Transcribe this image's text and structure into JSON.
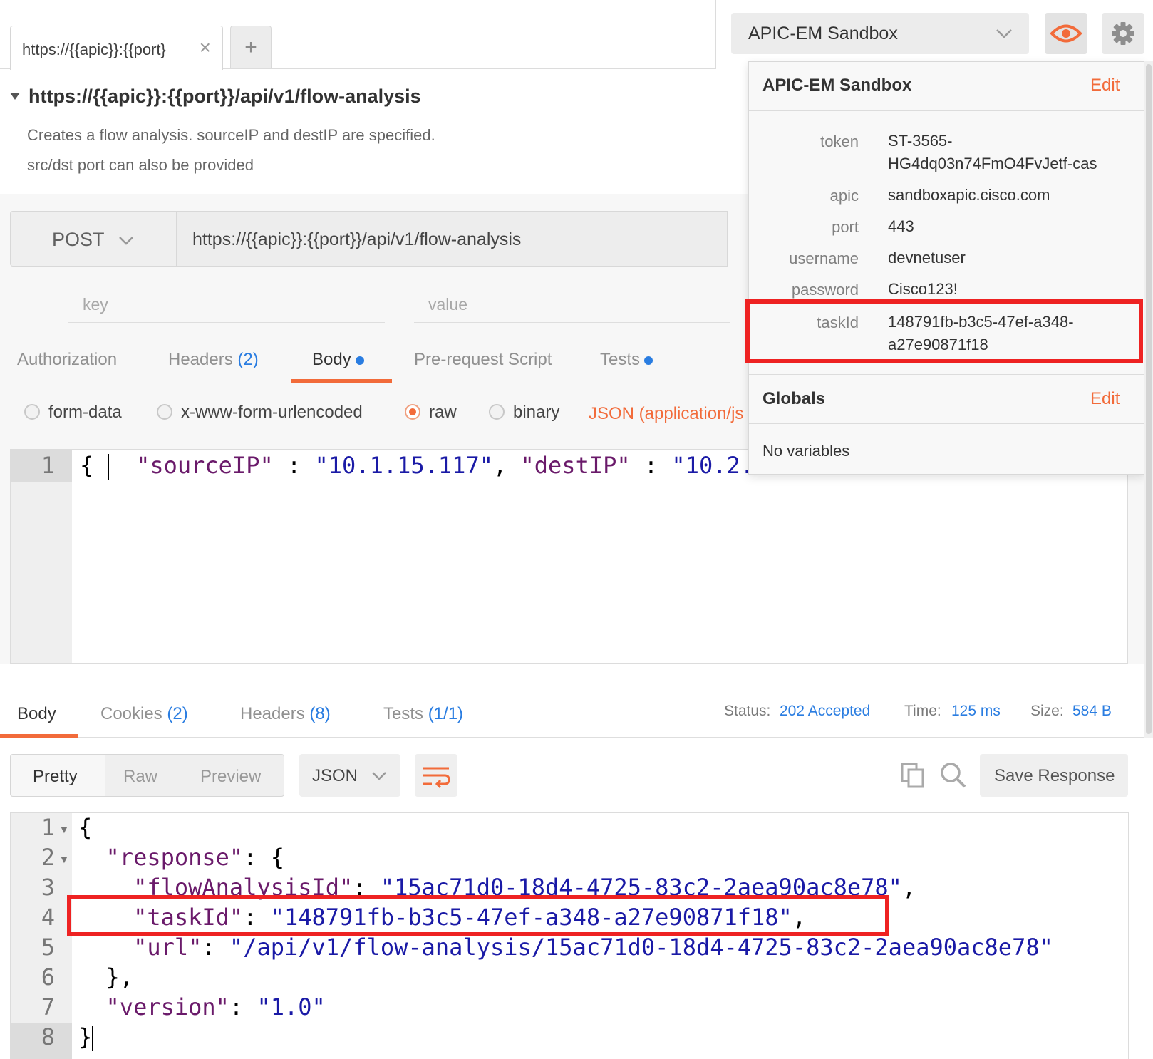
{
  "tab": {
    "label": "https://{{apic}}:{{port}",
    "add": "+"
  },
  "env": {
    "selected": "APIC-EM Sandbox"
  },
  "request": {
    "title": "https://{{apic}}:{{port}}/api/v1/flow-analysis",
    "description_line1": "Creates a flow analysis. sourceIP and destIP are specified.",
    "description_line2": "src/dst port can also be provided",
    "method": "POST",
    "url": "https://{{apic}}:{{port}}/api/v1/flow-analysis",
    "params": {
      "key_placeholder": "key",
      "value_placeholder": "value"
    }
  },
  "request_tabs": {
    "authorization": "Authorization",
    "headers": "Headers",
    "headers_count": "(2)",
    "body": "Body",
    "prerequest": "Pre-request Script",
    "tests": "Tests"
  },
  "body_types": {
    "form_data": "form-data",
    "urlencoded": "x-www-form-urlencoded",
    "raw": "raw",
    "binary": "binary",
    "json_type": "JSON (application/js"
  },
  "request_body": {
    "line_no": "1",
    "open": "{ ",
    "k1": "\"sourceIP\"",
    "sep1": " : ",
    "v1": "\"10.1.15.117\"",
    "comma": ", ",
    "k2": "\"destIP\"",
    "sep2": " : ",
    "v2": "\"10.2."
  },
  "response_tabs": {
    "body": "Body",
    "cookies": "Cookies",
    "cookies_count": "(2)",
    "headers": "Headers",
    "headers_count": "(8)",
    "tests": "Tests",
    "tests_count": "(1/1)"
  },
  "response_status": {
    "status_label": "Status:",
    "status_value": "202 Accepted",
    "time_label": "Time:",
    "time_value": "125 ms",
    "size_label": "Size:",
    "size_value": "584 B"
  },
  "response_view": {
    "pretty": "Pretty",
    "raw": "Raw",
    "preview": "Preview",
    "format": "JSON",
    "save": "Save Response"
  },
  "response_body": {
    "line_numbers": [
      "1",
      "2",
      "3",
      "4",
      "5",
      "6",
      "7",
      "8"
    ],
    "l1": "{",
    "l2_k": "  \"response\"",
    "l2_r": ": {",
    "l3_k": "    \"flowAnalysisId\"",
    "l3_c": ": ",
    "l3_v": "\"15ac71d0-18d4-4725-83c2-2aea90ac8e78\"",
    "l3_e": ",",
    "l4_k": "    \"taskId\"",
    "l4_c": ": ",
    "l4_v": "\"148791fb-b3c5-47ef-a348-a27e90871f18\"",
    "l4_e": ",",
    "l5_k": "    \"url\"",
    "l5_c": ": ",
    "l5_v": "\"/api/v1/flow-analysis/15ac71d0-18d4-4725-83c2-2aea90ac8e78\"",
    "l6": "  },",
    "l7_k": "  \"version\"",
    "l7_c": ": ",
    "l7_v": "\"1.0\"",
    "l8": "}"
  },
  "popup": {
    "env_title": "APIC-EM Sandbox",
    "edit": "Edit",
    "vars": [
      {
        "key": "token",
        "value": "ST-3565-HG4dq03n74FmO4FvJetf-cas"
      },
      {
        "key": "apic",
        "value": "sandboxapic.cisco.com"
      },
      {
        "key": "port",
        "value": "443"
      },
      {
        "key": "username",
        "value": "devnetuser"
      },
      {
        "key": "password",
        "value": "Cisco123!"
      },
      {
        "key": "taskId",
        "value": "148791fb-b3c5-47ef-a348-a27e90871f18"
      }
    ],
    "globals_title": "Globals",
    "globals_edit": "Edit",
    "no_vars": "No variables"
  },
  "colors": {
    "accent": "#f26b3a",
    "link": "#2a7de1",
    "highlight": "#ee2222"
  }
}
